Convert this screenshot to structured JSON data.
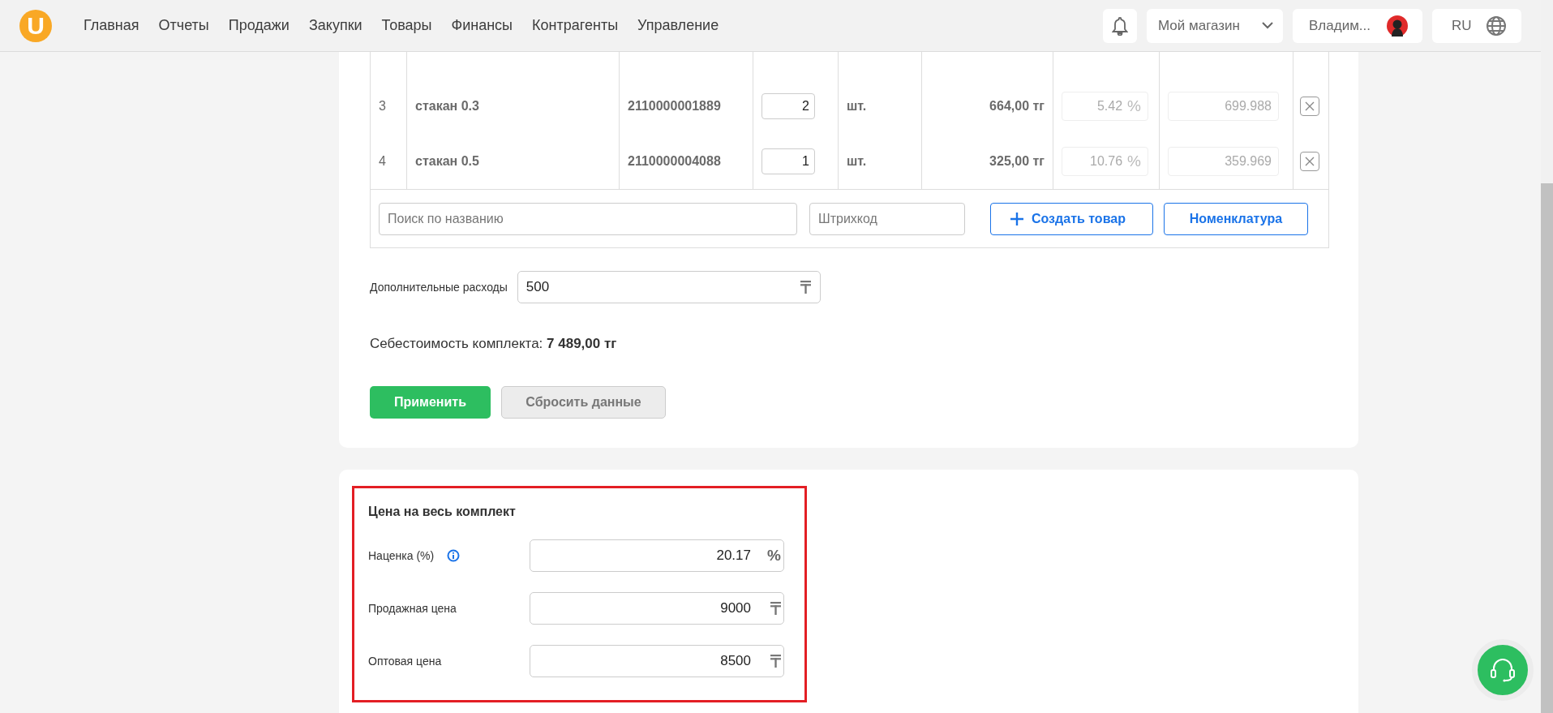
{
  "header": {
    "logo": "U",
    "nav": [
      {
        "label": "Главная"
      },
      {
        "label": "Отчеты"
      },
      {
        "label": "Продажи"
      },
      {
        "label": "Закупки"
      },
      {
        "label": "Товары"
      },
      {
        "label": "Финансы"
      },
      {
        "label": "Контрагенты"
      },
      {
        "label": "Управление"
      }
    ],
    "store": "Мой магазин",
    "user": "Владим...",
    "language": "RU"
  },
  "table": {
    "rows": [
      {
        "number": "3",
        "name": "стакан 0.3",
        "barcode": "2110000001889",
        "quantity": "2",
        "unit": "шт.",
        "cost": "664,00 тг",
        "markup": "5.42",
        "markup_suffix": "%",
        "price": "699.988",
        "disabled": true
      },
      {
        "number": "4",
        "name": "стакан 0.5",
        "barcode": "2110000004088",
        "quantity": "1",
        "unit": "шт.",
        "cost": "325,00 тг",
        "markup": "10.76",
        "markup_suffix": "%",
        "price": "359.969",
        "disabled": true
      }
    ],
    "search_placeholder": "Поиск по названию",
    "barcode_placeholder": "Штрихкод",
    "create_button": "Создать товар",
    "catalog_button": "Номенклатура"
  },
  "extra_expenses": {
    "label": "Дополнительные расходы",
    "value": "500"
  },
  "cost_line": "Себестоимость комплекта: **7 489,00 тг**",
  "actions": [
    {
      "label": "Применить",
      "kind": "primary"
    },
    {
      "label": "Сбросить данные",
      "kind": "secondary"
    }
  ],
  "price_panel": {
    "title": "Цена на весь комплект",
    "highlighted": true,
    "rows": [
      {
        "label": "Наценка (%)",
        "info": true,
        "value": "20.17",
        "kind": "percent",
        "suffix": "%"
      },
      {
        "label": "Продажная цена",
        "info": false,
        "value": "9000",
        "kind": "currency"
      },
      {
        "label": "Оптовая цена",
        "info": false,
        "value": "8500",
        "kind": "currency"
      }
    ]
  }
}
